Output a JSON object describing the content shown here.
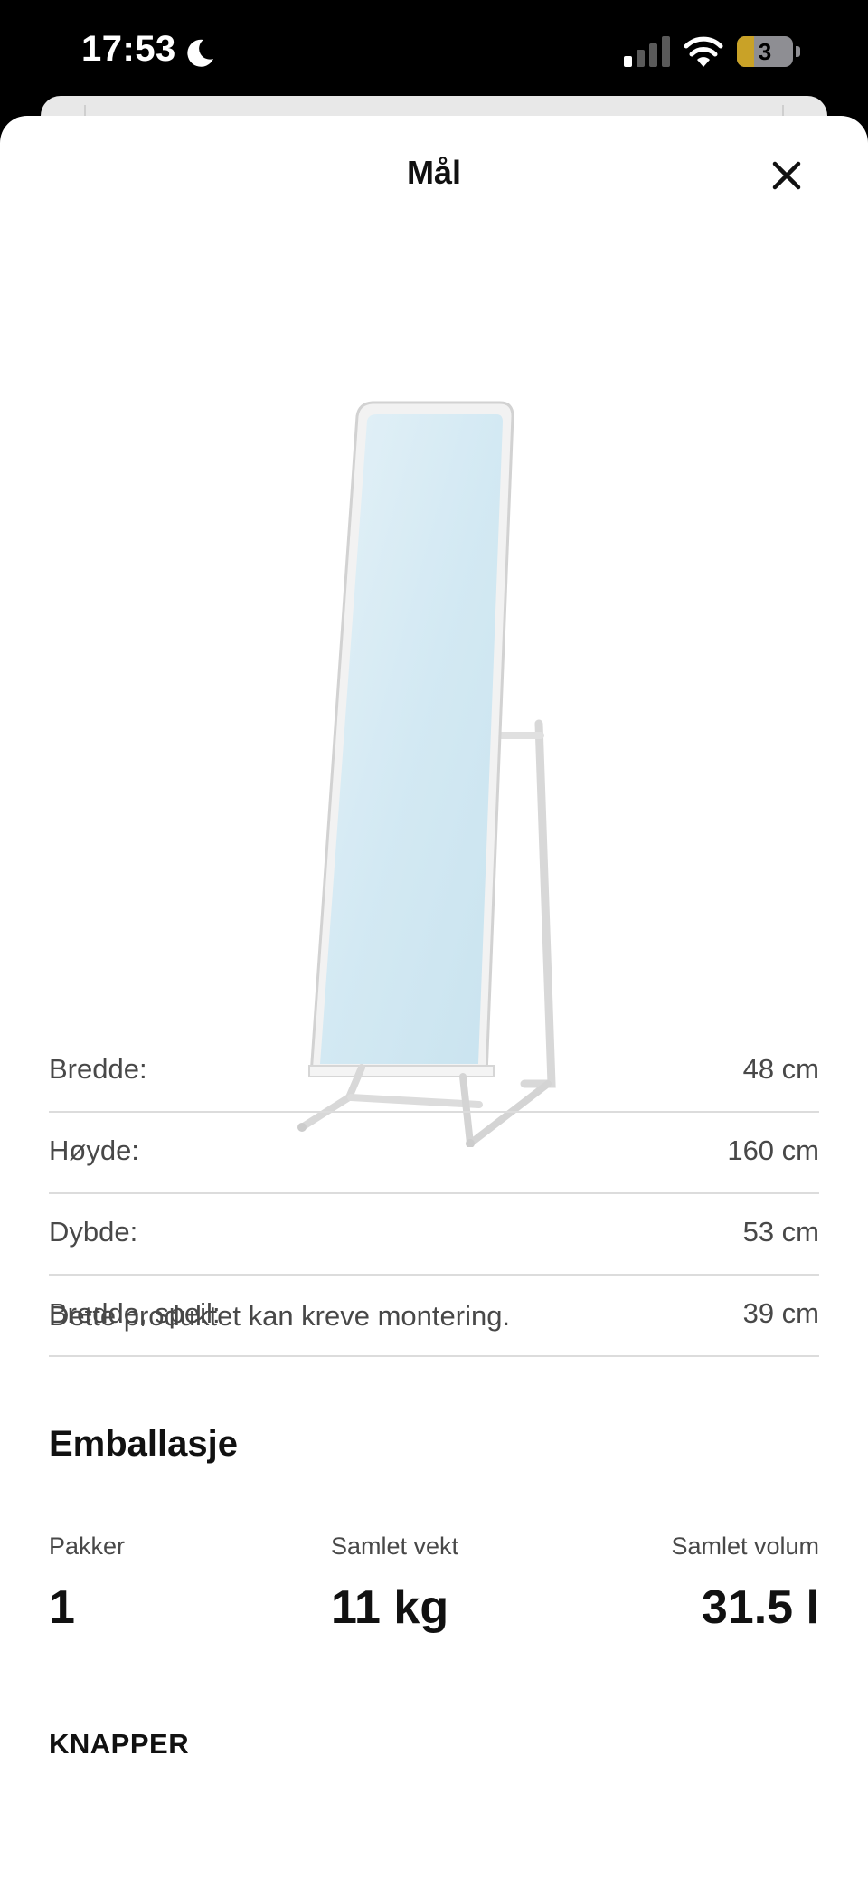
{
  "status_bar": {
    "time": "17:53",
    "battery_level": "3",
    "battery_fraction": 0.3,
    "focus_icon": "moon-icon",
    "signal_icon": "cellular-signal-icon",
    "wifi_icon": "wifi-icon"
  },
  "sheet": {
    "title": "Mål",
    "close_icon": "close-icon"
  },
  "product": {
    "image_icon": "standing-mirror-image",
    "name": "KNAPPER"
  },
  "dimensions": [
    {
      "label": "Bredde:",
      "value": "48 cm"
    },
    {
      "label": "Høyde:",
      "value": "160 cm"
    },
    {
      "label": "Dybde:",
      "value": "53 cm"
    },
    {
      "label": "Bredde, speil:",
      "value": "39 cm"
    }
  ],
  "assembly_note": "Dette produktet kan kreve montering.",
  "packaging": {
    "heading": "Emballasje",
    "items": [
      {
        "label": "Pakker",
        "value": "1"
      },
      {
        "label": "Samlet vekt",
        "value": "11 kg"
      },
      {
        "label": "Samlet volum",
        "value": "31.5 l"
      }
    ]
  },
  "colors": {
    "status_bar_bg": "#000000",
    "sheet_bg": "#ffffff",
    "text_primary": "#111111",
    "text_secondary": "#484848",
    "divider": "#dcdcdc",
    "battery_fill": "#c9a227"
  }
}
